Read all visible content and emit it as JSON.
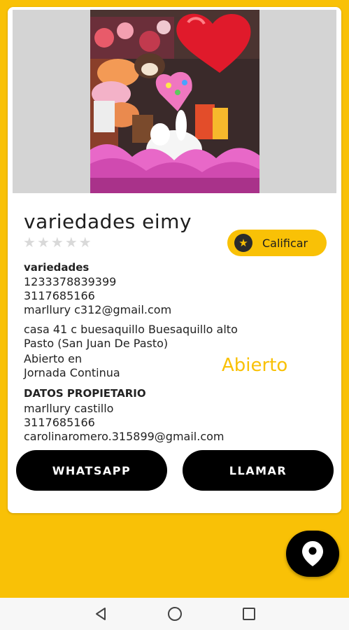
{
  "colors": {
    "accent": "#F9C106",
    "button": "#000000",
    "star_inactive": "#d9d9d9"
  },
  "business": {
    "name": "variedades eimy",
    "rating": 0,
    "rating_max": 5,
    "category": "variedades",
    "id_number": "1233378839399",
    "phone": "3117685166",
    "email": "marllury c312@gmail.com",
    "address_line1": "casa 41 c buesaquillo  Buesaquillo alto",
    "address_line2": "Pasto (San Juan De Pasto)",
    "hours_line1": "Abierto en",
    "hours_line2": "Jornada Continua",
    "status": "Abierto"
  },
  "rate_button": {
    "label": "Calificar",
    "icon": "star-icon"
  },
  "owner": {
    "heading": "DATOS PROPIETARIO",
    "name": "marllury castillo",
    "phone": "3117685166",
    "email": "carolinaromero.315899@gmail.com"
  },
  "actions": {
    "whatsapp_label": "WHATSAPP",
    "call_label": "LLAMAR"
  },
  "fab": {
    "icon": "location-pin-icon"
  },
  "navbar": {
    "back_icon": "back-triangle-icon",
    "home_icon": "home-circle-icon",
    "recents_icon": "recents-square-icon"
  }
}
